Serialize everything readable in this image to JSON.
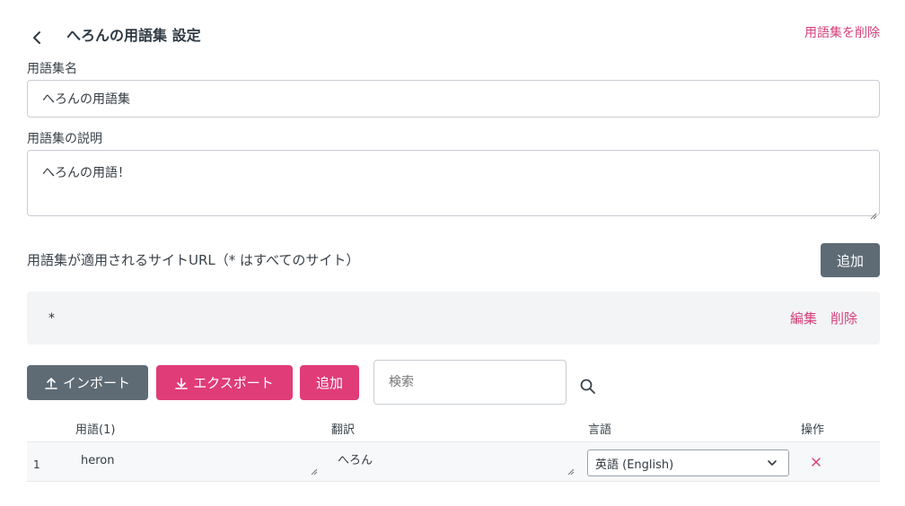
{
  "header": {
    "title": "へろんの用語集 設定",
    "delete_link": "用語集を削除"
  },
  "name_field": {
    "label": "用語集名",
    "value": "へろんの用語集"
  },
  "description_field": {
    "label": "用語集の説明",
    "value": "へろんの用語！"
  },
  "site_urls": {
    "label": "用語集が適用されるサイトURL（* はすべてのサイト）",
    "add_button": "追加",
    "items": [
      {
        "url": "*",
        "edit_label": "編集",
        "delete_label": "削除"
      }
    ]
  },
  "toolbar": {
    "import_button": "インポート",
    "export_button": "エクスポート",
    "add_button": "追加",
    "search_placeholder": "検索"
  },
  "table": {
    "columns": {
      "term": "用語(1)",
      "translation": "翻訳",
      "language": "言語",
      "actions": "操作"
    },
    "rows": [
      {
        "index": "1",
        "term": "heron",
        "translation": "へろん",
        "language": "英語 (English)"
      }
    ]
  },
  "colors": {
    "accent_pink": "#e03c78",
    "button_gray": "#5e6b75",
    "link_pink": "#d6407c"
  }
}
